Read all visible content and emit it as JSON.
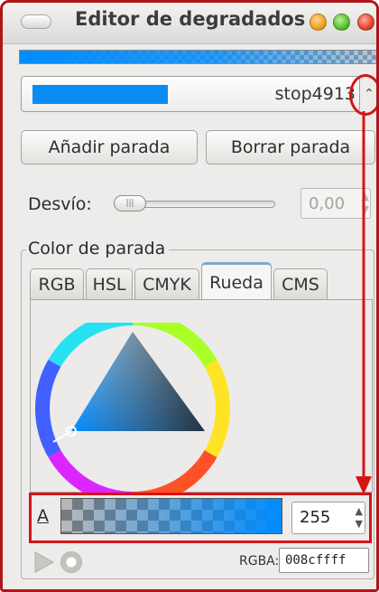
{
  "window": {
    "title": "Editor de degradados"
  },
  "stop": {
    "name": "stop4913",
    "color": "#0a8cf5"
  },
  "buttons": {
    "add": "Añadir parada",
    "delete": "Borrar parada"
  },
  "offset": {
    "label": "Desvío:",
    "value": "0,00",
    "slider_fraction": 0.0
  },
  "color_section": {
    "title": "Color de parada",
    "tabs": [
      "RGB",
      "HSL",
      "CMYK",
      "Rueda",
      "CMS"
    ],
    "active_tab": "Rueda"
  },
  "alpha": {
    "label": "A",
    "value": "255"
  },
  "rgba": {
    "label": "RGBA:",
    "value": "008cffff"
  },
  "icons": {
    "window_menu": "window-menu-icon",
    "minimize": "minimize-icon",
    "maximize": "maximize-icon",
    "close": "close-icon",
    "combo_arrows": "spin-arrows-icon",
    "color_managed": "color-managed-icon",
    "out_of_gamut": "out-of-gamut-icon"
  },
  "highlight_color": "#d51418"
}
